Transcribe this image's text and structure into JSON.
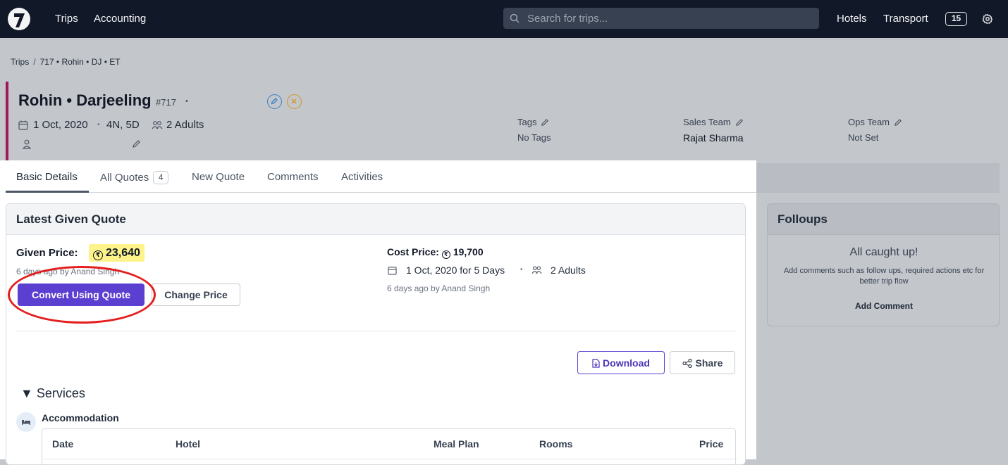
{
  "topbar": {
    "nav": [
      "Trips",
      "Accounting"
    ],
    "search_placeholder": "Search for trips...",
    "right_links": [
      "Hotels",
      "Transport"
    ],
    "notification_count": "15"
  },
  "breadcrumb": [
    "Trips",
    "717 • Rohin • DJ • ET"
  ],
  "trip": {
    "title": "Rohin • Darjeeling",
    "id": "#717",
    "dot": "•",
    "date": "1 Oct, 2020",
    "separator": "•",
    "duration": "4N, 5D",
    "travelers": "2 Adults",
    "tags_label": "Tags",
    "tags_value": "No Tags",
    "sales_label": "Sales Team",
    "sales_value": "Rajat Sharma",
    "ops_label": "Ops Team",
    "ops_value": "Not Set"
  },
  "tabs": [
    {
      "label": "Basic Details"
    },
    {
      "label": "All Quotes",
      "count": "4"
    },
    {
      "label": "New Quote"
    },
    {
      "label": "Comments"
    },
    {
      "label": "Activities"
    }
  ],
  "quote": {
    "heading": "Latest Given Quote",
    "given_label": "Given Price:",
    "given_value": "23,640",
    "rupee": "₹",
    "given_meta": "6 days ago by Anand Singh",
    "convert_label": "Convert Using Quote",
    "change_price_label": "Change Price",
    "cost_label": "Cost Price:",
    "cost_value": "19,700",
    "cost_dates": "1 Oct, 2020 for 5 Days",
    "cost_sep": "•",
    "cost_travelers": "2 Adults",
    "cost_meta": "6 days ago by Anand Singh",
    "download_label": "Download",
    "share_label": "Share",
    "services_label": "▼ Services",
    "accommodation_label": "Accommodation",
    "table_headers": [
      "Date",
      "Hotel",
      "Meal Plan",
      "Rooms",
      "Price"
    ]
  },
  "followups": {
    "heading": "Folloups",
    "title": "All caught up!",
    "description": "Add comments such as follow ups, required actions etc for better trip flow",
    "add_label": "Add Comment"
  },
  "colors": {
    "topbar": "#111827",
    "primary": "#5b3fd0",
    "accent_border": "#a3155c",
    "highlight": "#fdf38a",
    "annotation_ring": "#e41e1e"
  }
}
